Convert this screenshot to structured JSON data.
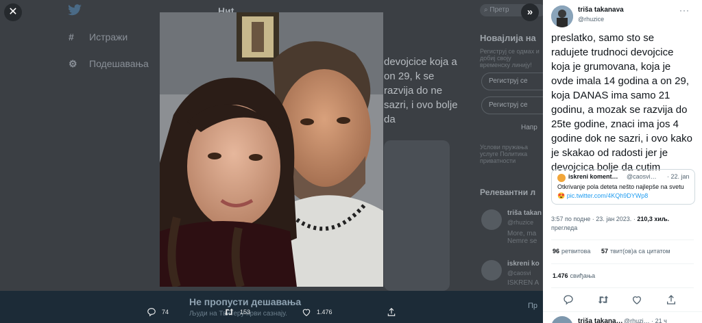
{
  "background": {
    "nav_items": [
      {
        "icon": "hashtag-icon",
        "label": "Истражи"
      },
      {
        "icon": "gear-icon",
        "label": "Подешавања"
      }
    ],
    "header": "Ниt",
    "tweet_fragment": "devojcice koja a on 29, k se razvija do ne sazri, i ovo bolje da",
    "right_title": "Новајлија на",
    "right_muted": "Региструј се одмах и добиј своју временску линију!",
    "pill1": "Региструј се",
    "pill2": "Региструј се",
    "link": "Напр",
    "terms": "Услови пружања услуге Политика приватности",
    "relevant_title": "Релевантни л",
    "rel_user1": "triša takan",
    "rel_handle1": "@rhuzice",
    "rel_text1": "More, ma Nemre se",
    "rel_user2": "iskreni ko",
    "rel_handle2": "@caosvi",
    "rel_text2": "ISKREN A",
    "banner_title": "Не пропусти дешавања",
    "banner_sub": "Људи на Твитеру први сазнају.",
    "banner_right": "Пр",
    "search_placeholder": "Претр"
  },
  "actions": {
    "replies": "74",
    "retweets": "153",
    "likes": "1.476"
  },
  "tweet": {
    "display_name": "triša takanava",
    "handle": "@rhuzice",
    "text": "preslatko, samo sto se radujete trudnoci devojcice koja je grumovana, koja je ovde imala 14 godina a on 29, koja DANAS ima samo 21 godinu, a mozak se razvija do 25te godine, znaci ima jos 4 godine dok ne sazri, i ovo kako je skakao od radosti jer je devojcica bolje da cutim",
    "quote": {
      "name": "iskreni koment…",
      "handle": "@caosvi…",
      "date": "· 22. jan",
      "text": "Otkrivanje pola deteta nešto najlepše na svetu 😍 ",
      "link": "pic.twitter.com/4KQh9DYWp8"
    },
    "timestamp": "3:57 по подне · 23. јан 2023. ·",
    "views_count": "210,3 хиљ.",
    "views_label": "прегледа",
    "retweets_count": "96",
    "retweets_label": "ретвитова",
    "quotes_count": "57",
    "quotes_label": "твит(ов)а са цитатом",
    "likes_count": "1.476",
    "likes_label": "свиђања"
  },
  "next_reply": {
    "display_name": "triša takana…",
    "handle": "@rhuzi…",
    "date": "· 21 ч"
  },
  "colors": {
    "accent": "#1d9bf0",
    "overlay": "#3b3f44",
    "panel": "#ffffff"
  }
}
